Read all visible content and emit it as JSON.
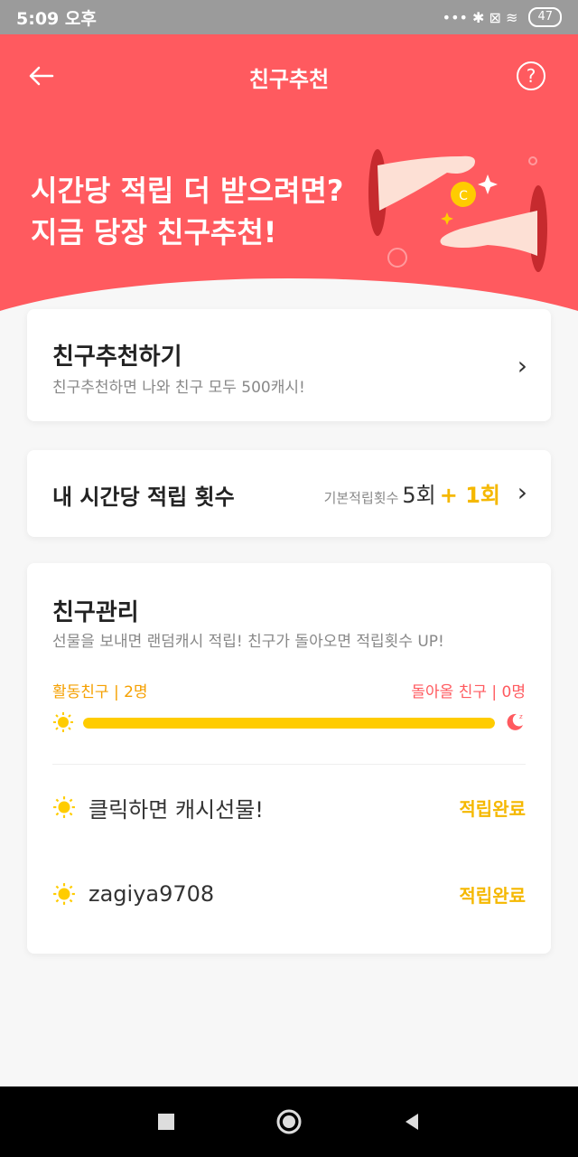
{
  "status": {
    "time": "5:09 오후",
    "icons": "••• ✱ ⊠ ≋",
    "battery": "47"
  },
  "header": {
    "title": "친구추천"
  },
  "hero": {
    "line1": "시간당 적립 더 받으려면?",
    "line2": "지금 당장 친구추천!"
  },
  "recommend_card": {
    "title": "친구추천하기",
    "subtitle": "친구추천하면 나와 친구 모두 500캐시!"
  },
  "count_card": {
    "title": "내 시간당 적립 횟수",
    "base_label": "기본적립횟수",
    "base_value": "5회",
    "bonus_value": "+ 1회"
  },
  "friends_card": {
    "title": "친구관리",
    "subtitle": "선물을 보내면 랜덤캐시 적립! 친구가 돌아오면 적립횟수 UP!",
    "active_label": "활동친구 | 2명",
    "return_label": "돌아올 친구 | 0명",
    "active_ratio": 1.0,
    "friends": [
      {
        "name": "클릭하면 캐시선물!",
        "status": "적립완료"
      },
      {
        "name": "zagiya9708",
        "status": "적립완료"
      }
    ]
  },
  "colors": {
    "brand": "#ff5a5f",
    "accent": "#f5b800"
  }
}
